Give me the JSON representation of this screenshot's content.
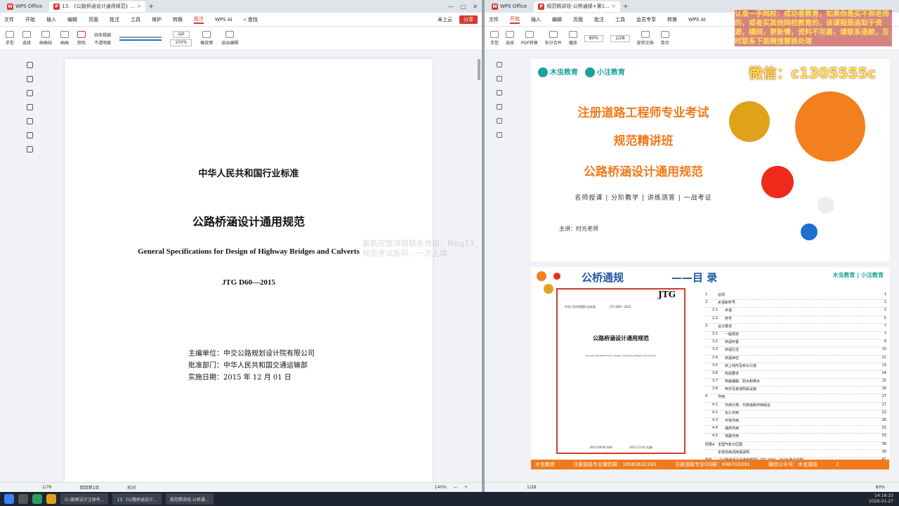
{
  "left_window": {
    "tabs": [
      {
        "label": "WPS Office"
      },
      {
        "label": "13. 《公路桥涵设计通用规范》..."
      }
    ],
    "menu": [
      "文件",
      "开始",
      "插入",
      "编辑",
      "页面",
      "批注",
      "工具",
      "保护",
      "转换",
      "批注",
      "WPS AI"
    ],
    "menu_active": "批注",
    "search_placeholder": "查找",
    "cloud_label": "未上云",
    "share_label": "分享",
    "toolbar": {
      "hand": "手型",
      "select": "选择",
      "ink": "画曲线",
      "pen": "画画",
      "color": "颜色",
      "opacity_label": "线条粗细",
      "transparency_label": "不透明度",
      "size_value": "2pt",
      "percent_value": "100%",
      "eraser": "橡皮擦",
      "exit": "退出编辑"
    },
    "document": {
      "line1": "中华人民共和国行业标准",
      "title": "公路桥涵设计通用规范",
      "title_en": "General Specifications for Design of Highway Bridges and Culverts",
      "code": "JTG  D60—2015",
      "editor": "主编单位：中交公路规划设计院有限公司",
      "approver": "批准部门：中华人民共和国交通运输部",
      "date": "实施日期：2015 年 12 月 01 日"
    },
    "watermark_lines": [
      "最新完整课程联系微信：fkbg13_",
      "规范考试新科，一次上岸"
    ],
    "status": {
      "page": "1/76",
      "mode": "回到第1页",
      "proof": "校对",
      "zoom": "140%"
    }
  },
  "right_window": {
    "tabs": [
      {
        "label": "WPS Office"
      },
      {
        "label": "规范精讲班-公桥通规+第1..."
      }
    ],
    "menu": [
      "文件",
      "开始",
      "插入",
      "编辑",
      "页面",
      "批注",
      "工具",
      "会员专享",
      "转换",
      "WPS AI"
    ],
    "menu_active": "开始",
    "toolbar": {
      "hand": "手型",
      "select": "选择",
      "pdf": "PDF转换",
      "split": "拆分合并",
      "zoom_value": "80%",
      "page_value": "1/28",
      "rotate": "旋转文档",
      "single": "单页",
      "play": "播放"
    },
    "slide1": {
      "logo1": "木虫教育",
      "logo2": "小注教育",
      "title1": "注册道路工程师专业考试",
      "title2": "规范精讲班",
      "title3": "公路桥涵设计通用规范",
      "subtitle": "名师授课 | 分阶教学 | 讲练测答 | 一战考证",
      "lecturer": "主讲：时光老师"
    },
    "slide2": {
      "title": "公桥通规",
      "title2": "——目  录",
      "logos": "木虫教育 | 小注教育",
      "book": {
        "jtg": "JTG",
        "line1": "中华人民共和国行业标准",
        "code": "JTG D60—2015",
        "title": "公路桥涵设计通用规范",
        "en": "General Specifications for Design of Highway Bridges and Culverts",
        "pub": "2015-09-09 发布",
        "impl": "2015-12-01 实施",
        "org": "中华人民共和国交通运输部发布"
      },
      "toc": [
        {
          "num": "1",
          "text": "总则",
          "page": "1",
          "sub": false
        },
        {
          "num": "2",
          "text": "术语和符号",
          "page": "2",
          "sub": false
        },
        {
          "num": "2.1",
          "text": "术语",
          "page": "2",
          "sub": true
        },
        {
          "num": "2.2",
          "text": "符号",
          "page": "5",
          "sub": true
        },
        {
          "num": "3",
          "text": "设计要求",
          "page": "7",
          "sub": false
        },
        {
          "num": "3.1",
          "text": "一般规定",
          "page": "7",
          "sub": true
        },
        {
          "num": "3.2",
          "text": "桥涵布置",
          "page": "8",
          "sub": true
        },
        {
          "num": "3.3",
          "text": "桥涵孔径",
          "page": "10",
          "sub": true
        },
        {
          "num": "3.4",
          "text": "桥涵净空",
          "page": "11",
          "sub": true
        },
        {
          "num": "3.5",
          "text": "桥上线形及桥头引道",
          "page": "13",
          "sub": true
        },
        {
          "num": "3.6",
          "text": "构造要求",
          "page": "14",
          "sub": true
        },
        {
          "num": "3.7",
          "text": "桥面铺装、防水和排水",
          "page": "15",
          "sub": true
        },
        {
          "num": "3.8",
          "text": "养护及其他附属设施",
          "page": "16",
          "sub": true
        },
        {
          "num": "4",
          "text": "作用",
          "page": "17",
          "sub": false
        },
        {
          "num": "4.1",
          "text": "作用分类、代表值和作用组合",
          "page": "17",
          "sub": true
        },
        {
          "num": "4.2",
          "text": "永久作用",
          "page": "22",
          "sub": true
        },
        {
          "num": "4.3",
          "text": "可变作用",
          "page": "26",
          "sub": true
        },
        {
          "num": "4.4",
          "text": "偶然作用",
          "page": "31",
          "sub": true
        },
        {
          "num": "4.5",
          "text": "地震作用",
          "page": "33",
          "sub": true
        },
        {
          "num": "附录A",
          "text": "全国气象分区图",
          "page": "38",
          "sub": false
        },
        {
          "num": "",
          "text": "本规范用词用语说明",
          "page": "39",
          "sub": false
        },
        {
          "num": "附件",
          "text": "《公路桥涵设计通用规范》(JTG D60—2015)条文说明",
          "page": "41",
          "sub": false
        }
      ],
      "footer": [
        "木虫教育",
        "注册道路专业微信群：18563632381",
        "注册道路专业QQ群：696703391",
        "微信公众号：木虫道路",
        "2"
      ]
    },
    "status": {
      "page": "1/28",
      "zoom": "80%"
    }
  },
  "overlay": {
    "text": "认准一手网校：成功者教育，如果你是买不到老师的，或者买其他网校教育的，该课程是盗取于资源，横网，更新慢，资料不完善，请联系退款，及时联系下面微信替换处理",
    "wechat": "微信：c1305555c"
  },
  "taskbar": {
    "apps": [
      "G:\\勘察设计注册考...",
      "13.《公路桥涵设计...",
      "规范精讲班-公桥通..."
    ],
    "time": "14:16:23",
    "date": "2026-01-27"
  }
}
